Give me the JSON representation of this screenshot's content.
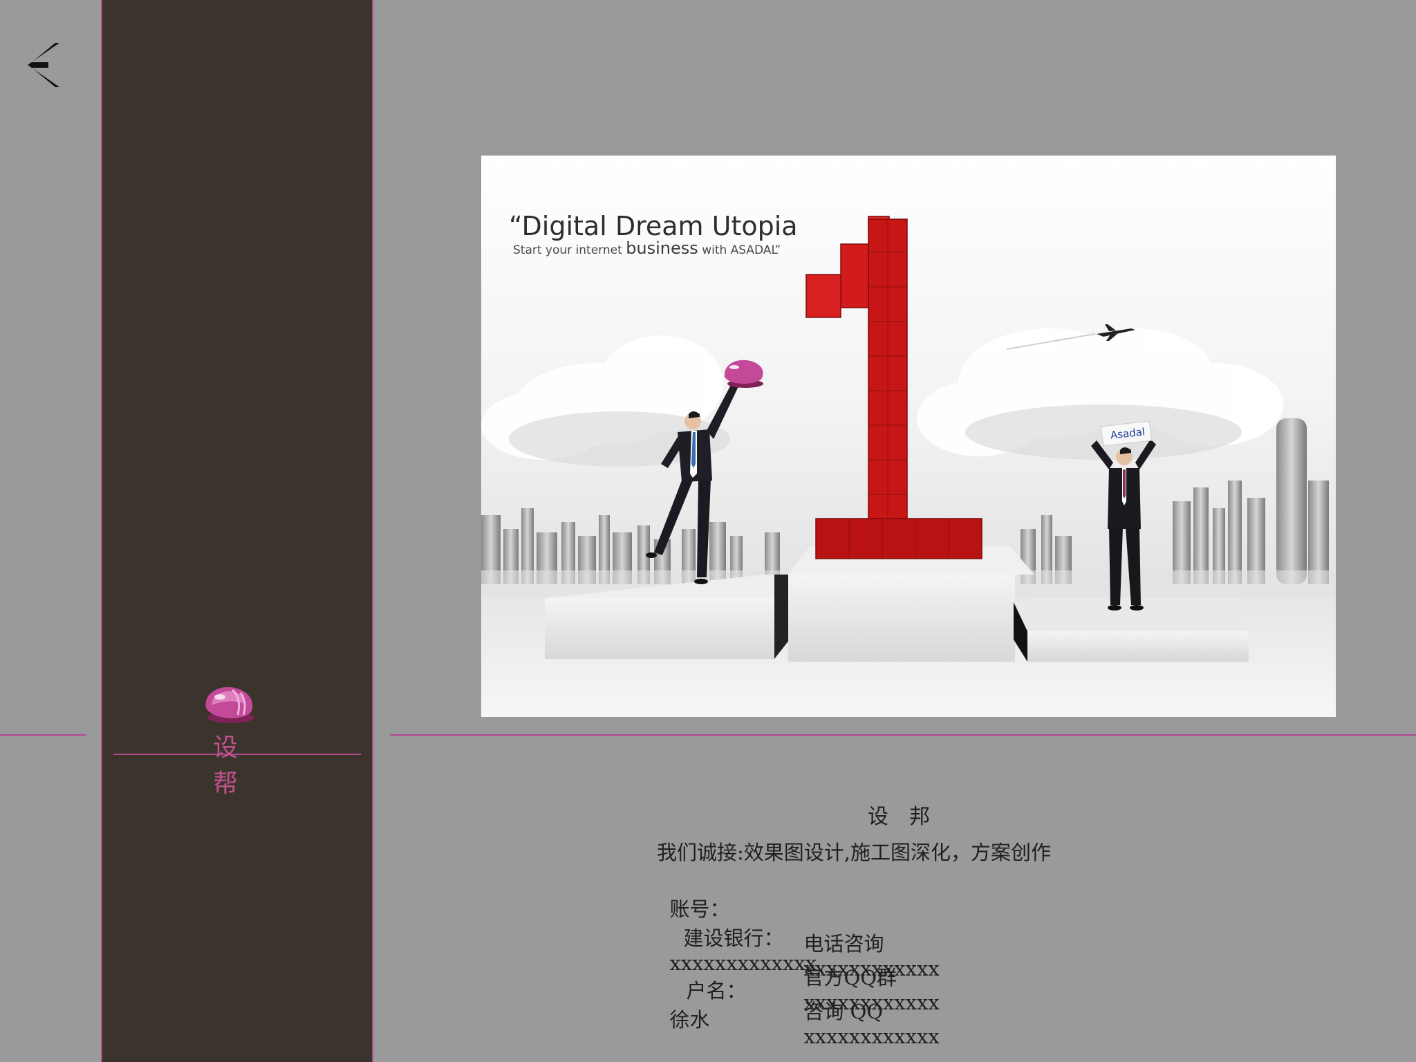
{
  "nav": {
    "back_icon": "chevron-left-icon"
  },
  "brand": {
    "logo_icon": "pink-gem-icon",
    "name": "设 帮",
    "accent_color": "#b04a8c"
  },
  "hero": {
    "title": "“Digital Dream Utopia",
    "subtitle_prefix": "Start your internet ",
    "subtitle_emphasis": "business",
    "subtitle_suffix": " with ASADAL”",
    "sign_text": "Asadal",
    "number_color": "#cc1f1f"
  },
  "info": {
    "company": "设　邦",
    "services": "我们诚接:效果图设计,施工图深化，方案创作",
    "account_label": "账号：",
    "bank": "建设银行：",
    "account_number": "xxxxxxxxxxxxx",
    "holder_label": "户名：",
    "holder_name": "徐水",
    "phone_label": "电话咨询",
    "phone_value": "xxxxxxxxxxxx",
    "qq_group_label": "官方QQ群",
    "qq_group_value": "xxxxxxxxxxxx",
    "qq_label": "咨询 QQ",
    "qq_value": "xxxxxxxxxxxx"
  }
}
